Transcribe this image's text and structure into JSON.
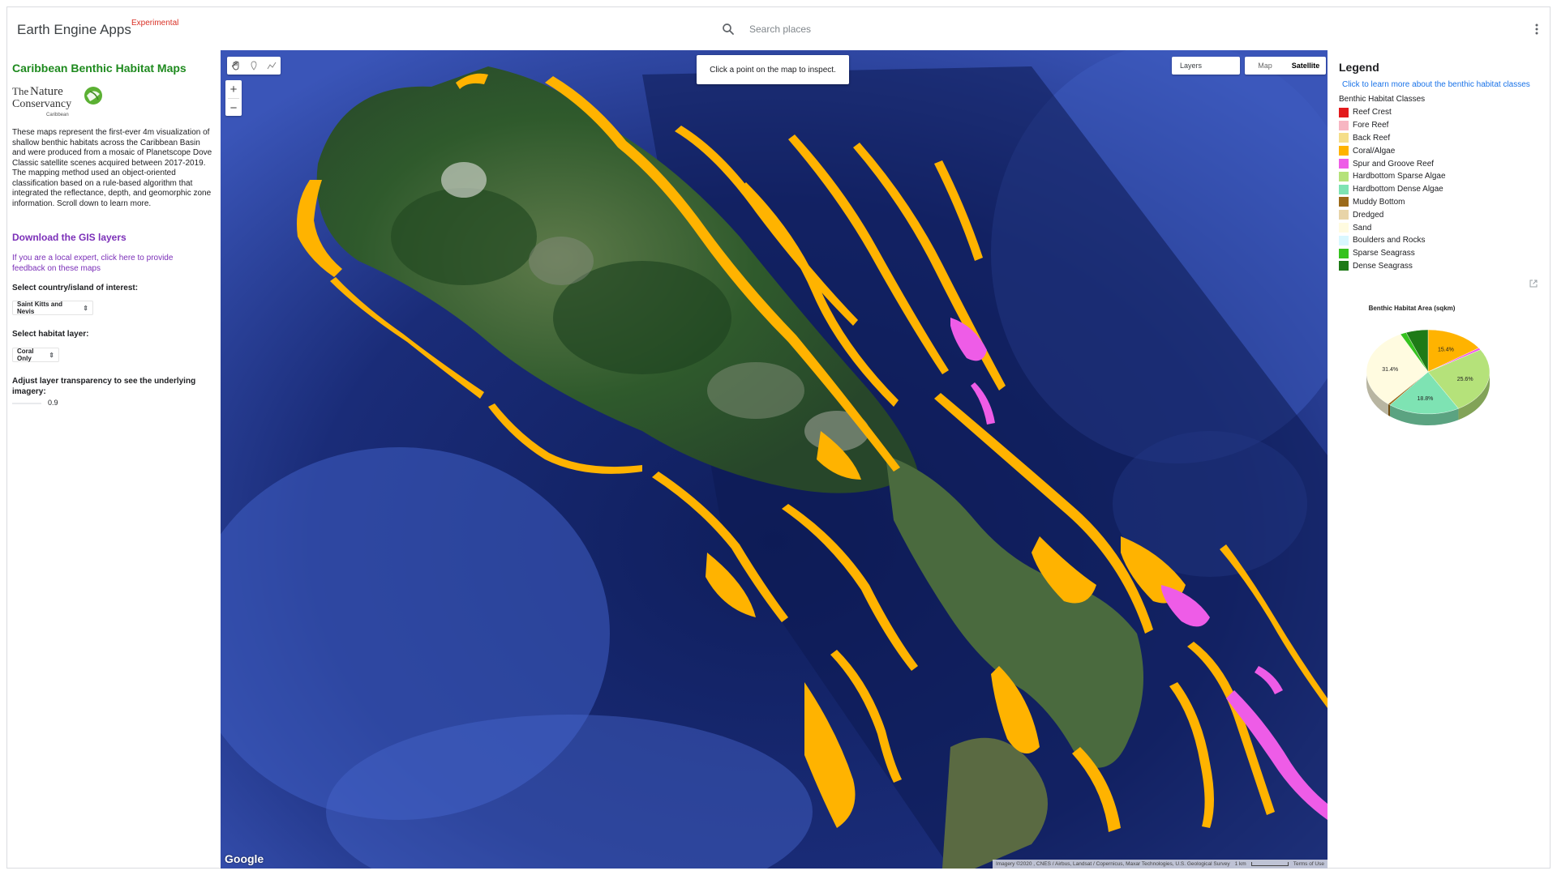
{
  "app": {
    "title": "Earth Engine Apps",
    "badge": "Experimental",
    "search_placeholder": "Search places",
    "more_icon": "more-vert-icon",
    "search_icon": "search-icon"
  },
  "left_panel": {
    "title": "Caribbean Benthic Habitat Maps",
    "logo_text": "The Nature Conservancy",
    "logo_sub": "Caribbean",
    "description": "These maps represent the first-ever 4m visualization of shallow benthic habitats across the Caribbean Basin and were produced from a mosaic of Planetscope Dove Classic satellite scenes acquired between 2017-2019. The mapping method used an object-oriented classification based on a rule-based algorithm that integrated the reflectance, depth, and geomorphic zone information. Scroll down to learn more.",
    "download_link": "Download the GIS layers",
    "feedback_link": "If you are a local expert, click here to provide feedback on these maps",
    "country_label": "Select country/island of interest:",
    "country_value": "Saint Kitts and Nevis",
    "habitat_label": "Select habitat layer:",
    "habitat_value": "Coral Only",
    "transparency_label": "Adjust layer transparency to see the underlying imagery:",
    "transparency_value": "0.9"
  },
  "map": {
    "inspect_hint": "Click a point on the map to inspect.",
    "layers_label": "Layers",
    "map_type_options": [
      "Map",
      "Satellite"
    ],
    "map_type_selected": "Satellite",
    "google_label": "Google",
    "attribution": "Imagery ©2020 , CNES / Airbus, Landsat / Copernicus, Maxar Technologies, U.S. Geological Survey",
    "scale_label": "1 km",
    "terms_label": "Terms of Use",
    "zoom_in_label": "+",
    "zoom_out_label": "−",
    "tools": [
      "hand-icon",
      "point-icon",
      "line-icon"
    ]
  },
  "legend": {
    "title": "Legend",
    "link": "Click to learn more about the benthic habitat classes",
    "subtitle": "Benthic Habitat Classes",
    "items": [
      {
        "label": "Reef Crest",
        "color": "#e31a1c"
      },
      {
        "label": "Fore Reef",
        "color": "#f7b6c2"
      },
      {
        "label": "Back Reef",
        "color": "#f5de8a"
      },
      {
        "label": "Coral/Algae",
        "color": "#ffb300"
      },
      {
        "label": "Spur and Groove Reef",
        "color": "#ee5ce7"
      },
      {
        "label": "Hardbottom Sparse Algae",
        "color": "#b5e27a"
      },
      {
        "label": "Hardbottom Dense Algae",
        "color": "#7ee3b3"
      },
      {
        "label": "Muddy Bottom",
        "color": "#9c6b1a"
      },
      {
        "label": "Dredged",
        "color": "#e8d4a8"
      },
      {
        "label": "Sand",
        "color": "#fffbe0"
      },
      {
        "label": "Boulders and Rocks",
        "color": "#d9f7ff"
      },
      {
        "label": "Sparse Seagrass",
        "color": "#35c21e"
      },
      {
        "label": "Dense Seagrass",
        "color": "#1e7a17"
      }
    ],
    "external_icon": "open-in-new-icon"
  },
  "chart_data": {
    "type": "pie",
    "title": "Benthic Habitat Area (sqkm)",
    "slices": [
      {
        "label": "Coral/Algae",
        "value": 15.4,
        "color": "#ffb300",
        "show_label": "15.4%"
      },
      {
        "label": "Spur and Groove Reef",
        "value": 0.8,
        "color": "#ee5ce7",
        "show_label": ""
      },
      {
        "label": "Hardbottom Sparse Algae",
        "value": 25.6,
        "color": "#b5e27a",
        "show_label": "25.6%"
      },
      {
        "label": "Hardbottom Dense Algae",
        "value": 18.8,
        "color": "#7ee3b3",
        "show_label": "18.8%"
      },
      {
        "label": "Muddy Bottom",
        "value": 0.6,
        "color": "#9c6b1a",
        "show_label": ""
      },
      {
        "label": "Sand",
        "value": 31.4,
        "color": "#fffbe0",
        "show_label": "31.4%"
      },
      {
        "label": "Sparse Seagrass",
        "value": 1.6,
        "color": "#35c21e",
        "show_label": ""
      },
      {
        "label": "Dense Seagrass",
        "value": 5.8,
        "color": "#1e7a17",
        "show_label": ""
      }
    ]
  }
}
